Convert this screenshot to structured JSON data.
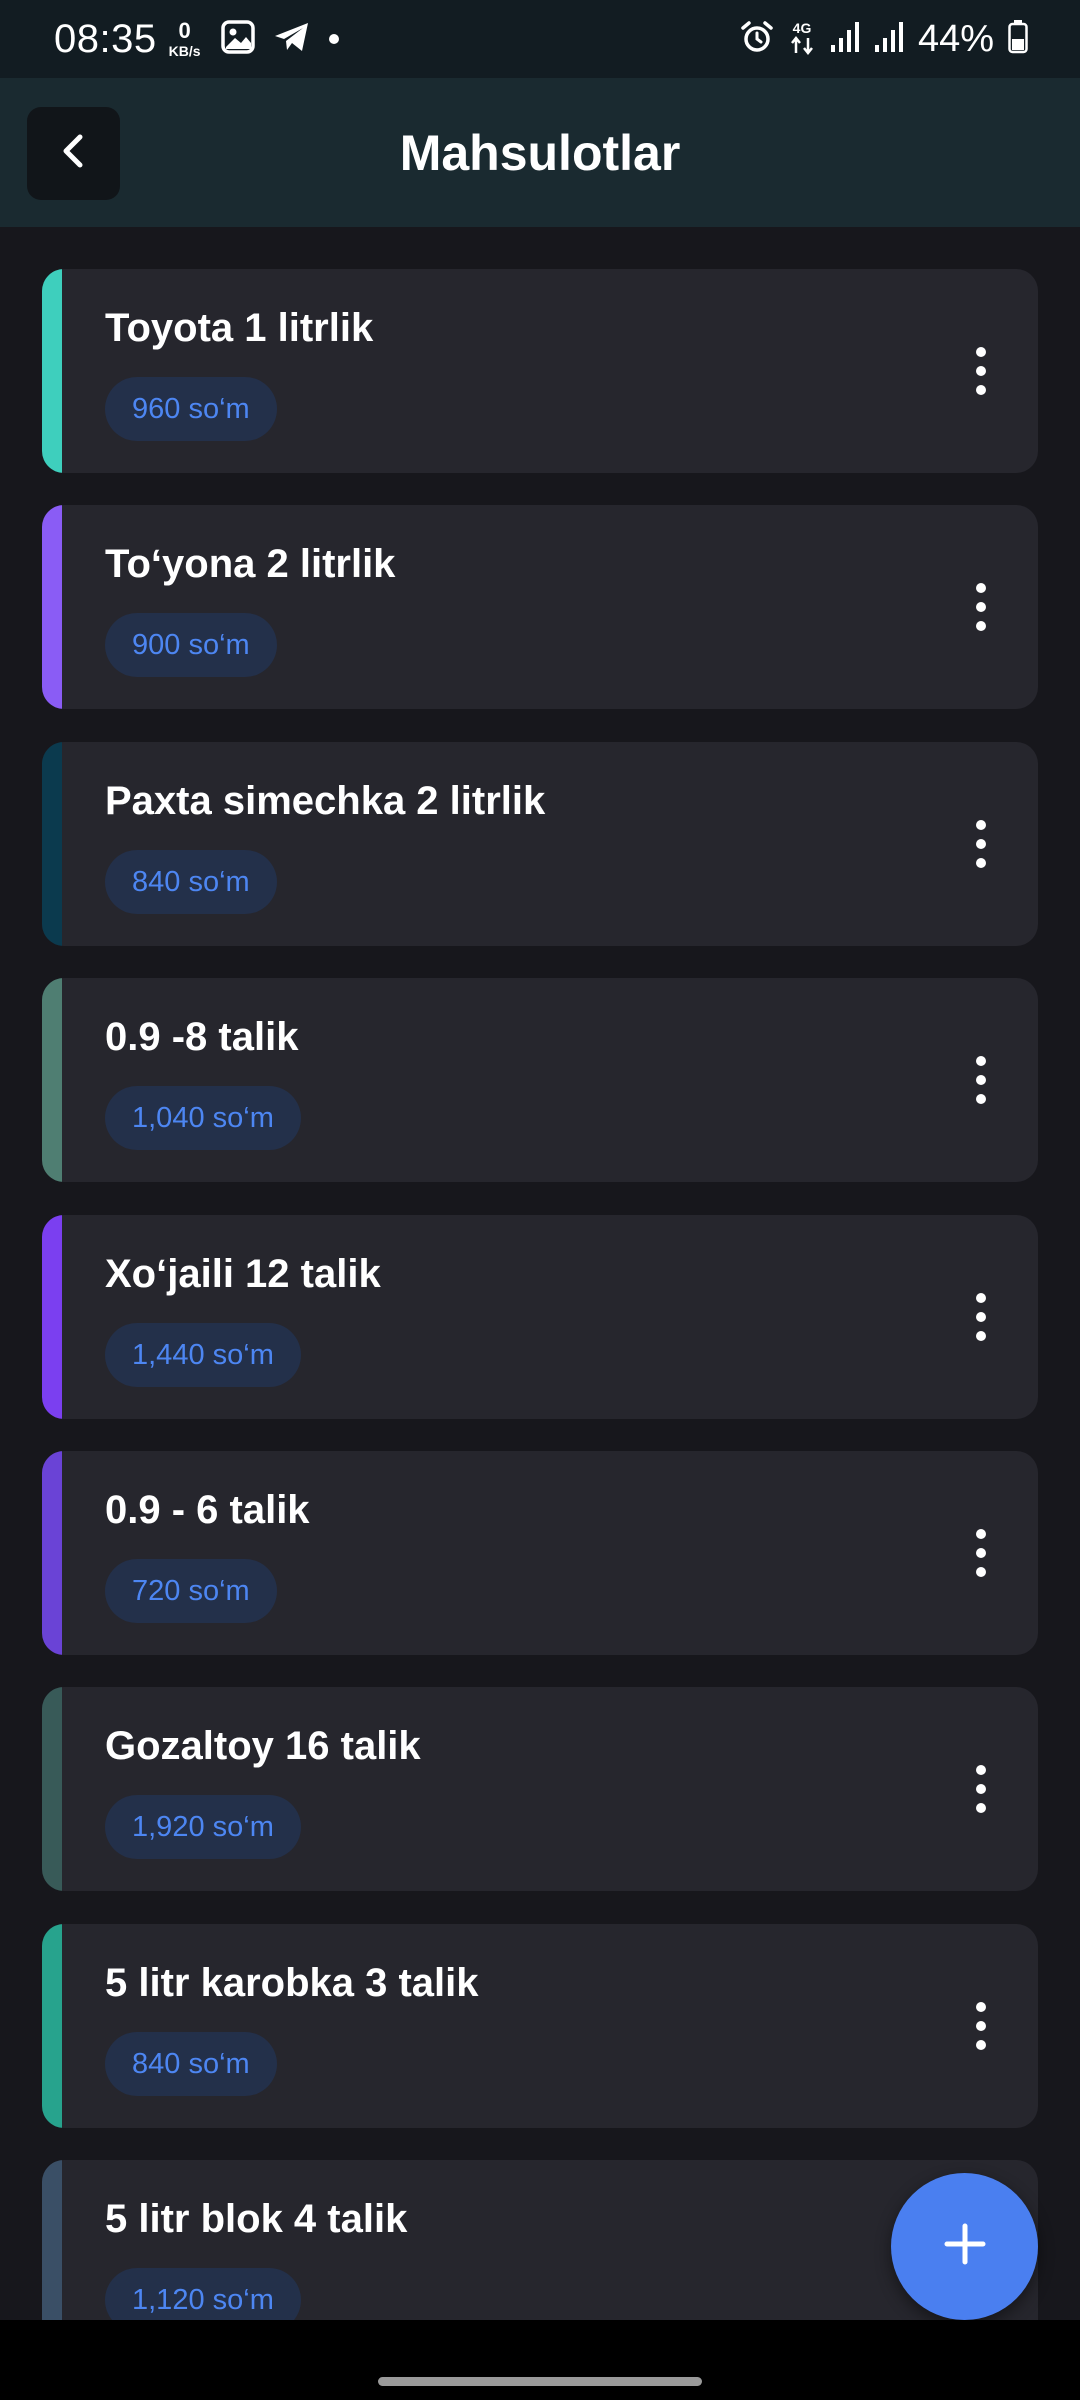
{
  "status_bar": {
    "time": "08:35",
    "net_speed_value": "0",
    "net_speed_unit": "KB/s",
    "network_type": "4G",
    "battery": "44%",
    "icons": [
      "gallery-icon",
      "telegram-icon",
      "notification-dot-icon",
      "alarm-icon",
      "data-arrows-icon",
      "signal-icon",
      "signal-icon",
      "battery-icon"
    ]
  },
  "header": {
    "title": "Mahsulotlar",
    "back_icon": "chevron-left-icon"
  },
  "products": [
    {
      "name": "Toyota 1 litrlik",
      "price": "960 so‘m",
      "accent": "#3ecfbd"
    },
    {
      "name": "To‘yona 2 litrlik",
      "price": "900 so‘m",
      "accent": "#8a5cf5"
    },
    {
      "name": "Paxta simechka 2 litrlik",
      "price": "840 so‘m",
      "accent": "#0b3a4e"
    },
    {
      "name": "0.9 -8 talik",
      "price": "1,040 so‘m",
      "accent": "#4f7e72"
    },
    {
      "name": "Xo‘jaili 12 talik",
      "price": "1,440 so‘m",
      "accent": "#7b3ff0"
    },
    {
      "name": "0.9 - 6 talik",
      "price": "720 so‘m",
      "accent": "#6a43d6"
    },
    {
      "name": "Gozaltoy 16 talik",
      "price": "1,920 so‘m",
      "accent": "#385a58"
    },
    {
      "name": "5 litr karobka 3 talik",
      "price": "840 so‘m",
      "accent": "#27a38d"
    },
    {
      "name": "5 litr blok 4 talik",
      "price": "1,120 so‘m",
      "accent": "#3a4f66"
    }
  ],
  "item_menu_icon": "more-vertical-icon",
  "fab": {
    "icon": "plus-icon",
    "color": "#4a7ff0"
  },
  "colors": {
    "background": "#17171c",
    "card": "#26262d",
    "app_bar": "#1a2a30",
    "price_chip_bg": "#23304a",
    "price_text": "#4d86f2"
  }
}
